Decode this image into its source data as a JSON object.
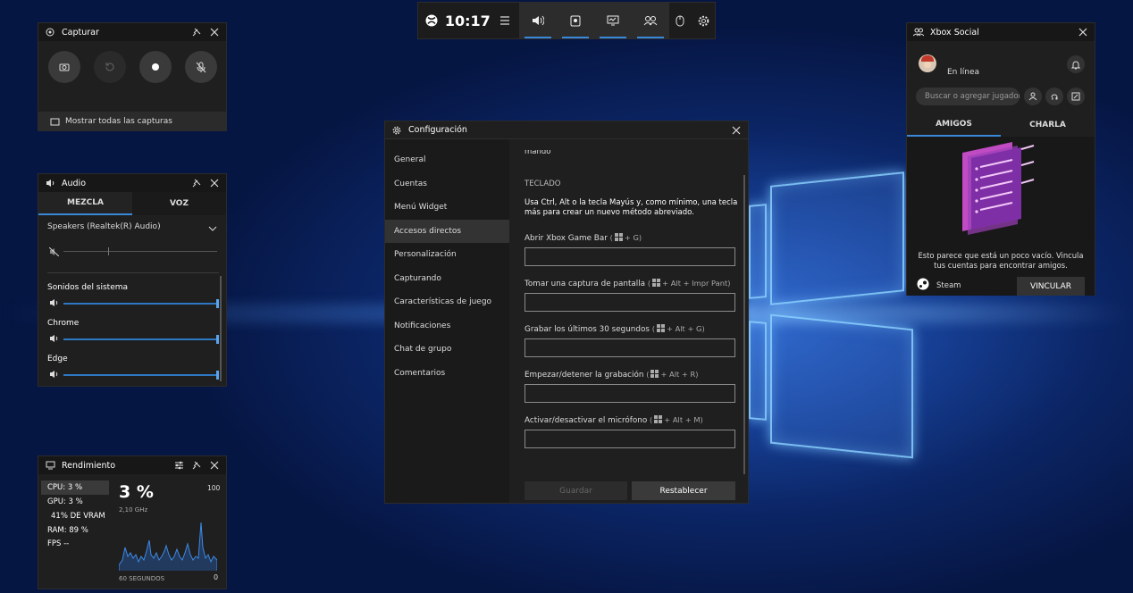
{
  "topbar": {
    "time": "10:17"
  },
  "capture": {
    "title": "Capturar",
    "show_all": "Mostrar todas las capturas"
  },
  "audio": {
    "title": "Audio",
    "tab_mix": "MEZCLA",
    "tab_voice": "VOZ",
    "device": "Speakers (Realtek(R) Audio)",
    "apps": [
      {
        "name": "Sonidos del sistema",
        "level": 1.0
      },
      {
        "name": "Chrome",
        "level": 1.0
      },
      {
        "name": "Edge",
        "level": 1.0
      }
    ]
  },
  "perf": {
    "title": "Rendimiento",
    "cpu": "CPU:   3 %",
    "gpu": "GPU:   3 %",
    "vram": "41% DE VRAM",
    "ram": "RAM:  89 %",
    "fps": "FPS  --",
    "big": "3 %",
    "freq": "2,10 GHz",
    "max": "100",
    "window": "60 SEGUNDOS",
    "min": "0"
  },
  "settings": {
    "title": "Configuración",
    "nav": [
      "General",
      "Cuentas",
      "Menú Widget",
      "Accesos directos",
      "Personalización",
      "Capturando",
      "Características de juego",
      "Notificaciones",
      "Chat de grupo",
      "Comentarios"
    ],
    "selected": 3,
    "cut": "mando",
    "section": "TECLADO",
    "desc": "Usa Ctrl, Alt o la tecla Mayús y, como mínimo, una tecla más para crear un nuevo método abreviado.",
    "shortcuts": [
      {
        "label": "Abrir Xbox Game Bar",
        "keys": "+ G)"
      },
      {
        "label": "Tomar una captura de pantalla",
        "keys": "+ Alt + Impr Pant)"
      },
      {
        "label": "Grabar los últimos 30 segundos",
        "keys": "+ Alt + G)"
      },
      {
        "label": "Empezar/detener la grabación",
        "keys": "+ Alt + R)"
      },
      {
        "label": "Activar/desactivar el micrófono",
        "keys": "+ Alt + M)"
      }
    ],
    "save": "Guardar",
    "reset": "Restablecer"
  },
  "social": {
    "title": "Xbox Social",
    "status": "En línea",
    "search_placeholder": "Buscar o agregar jugador",
    "tab_friends": "AMIGOS",
    "tab_chat": "CHARLA",
    "empty": "Esto parece que está un poco vacío. Vincula tus cuentas para encontrar amigos.",
    "steam": "Steam",
    "link": "VINCULAR"
  }
}
